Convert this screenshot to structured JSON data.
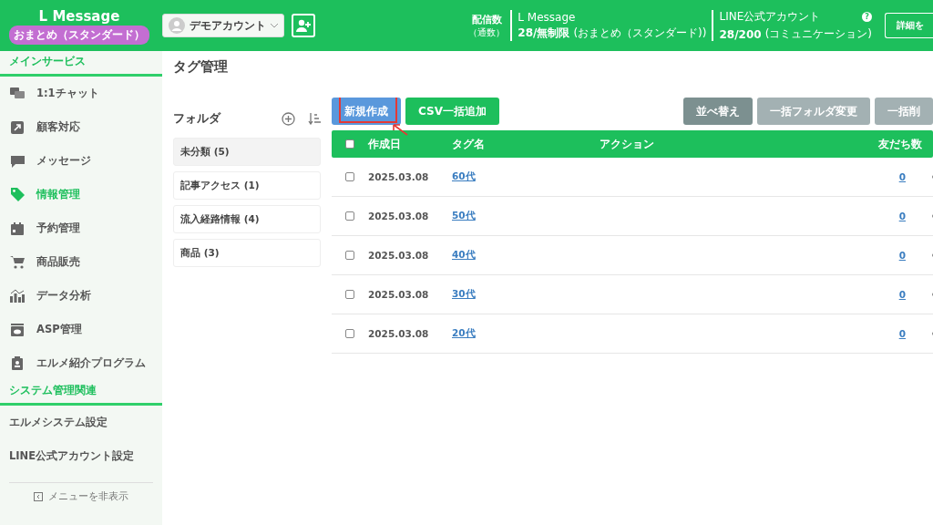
{
  "header": {
    "logo": "L Message",
    "plan_badge": "おまとめ（スタンダード）",
    "account": "デモアカウント",
    "stats_label": "配信数",
    "stats_sublabel": "（通数）",
    "stats": [
      {
        "title": "L Message",
        "value": "28/無制限",
        "note": "(おまとめ（スタンダード))"
      },
      {
        "title": "LINE公式アカウント",
        "value": "28/200",
        "note": "(コミュニケーション)"
      }
    ],
    "help": "?",
    "detail_button": "詳細を"
  },
  "sidebar": {
    "sections": [
      {
        "title": "メインサービス",
        "items": [
          {
            "label": "1:1チャット",
            "selected": false
          },
          {
            "label": "顧客対応",
            "selected": false
          },
          {
            "label": "メッセージ",
            "selected": false
          },
          {
            "label": "情報管理",
            "selected": true
          },
          {
            "label": "予約管理",
            "selected": false
          },
          {
            "label": "商品販売",
            "selected": false
          },
          {
            "label": "データ分析",
            "selected": false
          },
          {
            "label": "ASP管理",
            "selected": false
          },
          {
            "label": "エルメ紹介プログラム",
            "selected": false
          }
        ]
      },
      {
        "title": "システム管理関連",
        "items": [
          {
            "label": "エルメシステム設定",
            "selected": false
          },
          {
            "label": "LINE公式アカウント設定",
            "selected": false
          }
        ]
      }
    ],
    "hide_menu": "メニューを非表示"
  },
  "page_title": "タグ管理",
  "folders": {
    "title": "フォルダ",
    "items": [
      {
        "label": "未分類 (5)",
        "selected": true
      },
      {
        "label": "記事アクセス (1)",
        "selected": false
      },
      {
        "label": "流入経路情報 (4)",
        "selected": false
      },
      {
        "label": "商品 (3)",
        "selected": false
      }
    ]
  },
  "toolbar": [
    {
      "label": "新規作成",
      "kind": "primary",
      "highlighted": true
    },
    {
      "label": "CSV一括追加",
      "kind": "success",
      "highlighted": false
    },
    {
      "label": "並べ替え",
      "kind": "secondary",
      "highlighted": false
    },
    {
      "label": "一括フォルダ変更",
      "kind": "disabled",
      "highlighted": false
    },
    {
      "label": "一括削",
      "kind": "disabled",
      "highlighted": false
    }
  ],
  "table": {
    "columns": [
      "作成日",
      "タグ名",
      "アクション",
      "友だち数"
    ],
    "header_checked": false,
    "rows": [
      {
        "checked": false,
        "date": "2025.03.08",
        "tag": "60代",
        "friends": "0"
      },
      {
        "checked": false,
        "date": "2025.03.08",
        "tag": "50代",
        "friends": "0"
      },
      {
        "checked": false,
        "date": "2025.03.08",
        "tag": "40代",
        "friends": "0"
      },
      {
        "checked": false,
        "date": "2025.03.08",
        "tag": "30代",
        "friends": "0"
      },
      {
        "checked": false,
        "date": "2025.03.08",
        "tag": "20代",
        "friends": "0"
      }
    ]
  }
}
